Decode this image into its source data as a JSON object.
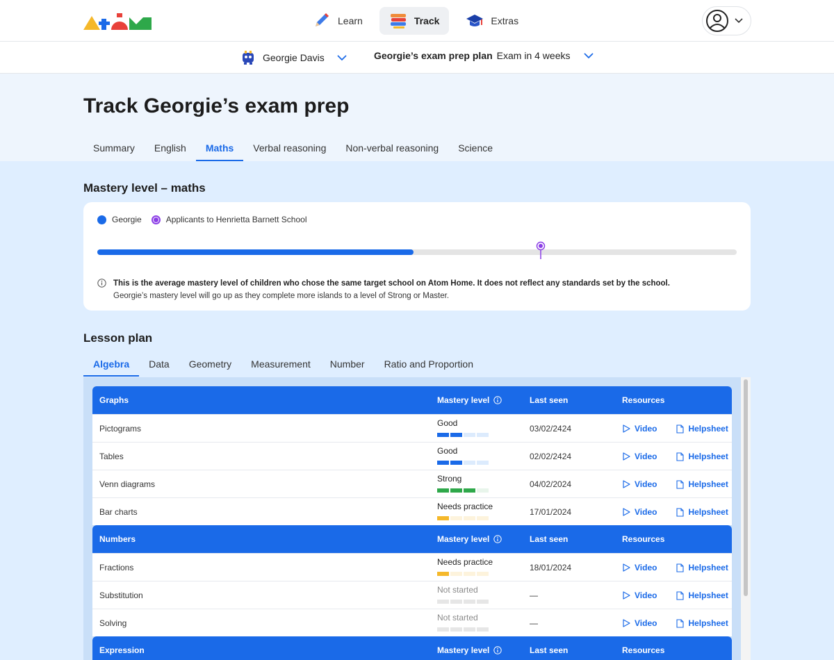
{
  "nav": {
    "items": [
      {
        "label": "Learn",
        "icon": "pencil-icon"
      },
      {
        "label": "Track",
        "icon": "books-icon"
      },
      {
        "label": "Extras",
        "icon": "graduation-cap-icon"
      }
    ]
  },
  "subnav": {
    "child_name": "Georgie Davis",
    "plan_name": "Georgie’s exam prep plan",
    "plan_exam": "Exam in 4 weeks"
  },
  "page": {
    "title": "Track Georgie’s exam prep",
    "tabs": [
      "Summary",
      "English",
      "Maths",
      "Verbal reasoning",
      "Non-verbal reasoning",
      "Science"
    ],
    "active_tab": "Maths"
  },
  "mastery": {
    "heading": "Mastery level – maths",
    "legend_child": "Georgie",
    "legend_applicants": "Applicants to Henrietta Barnett School",
    "child_level": 0.495,
    "applicants_level": 0.693,
    "note_bold": "This is the average mastery level of children who chose the same target school on Atom Home. It does not reflect any standards set by the school.",
    "note_text": "Georgie’s mastery level will go up as they complete more islands to a level of Strong or Master."
  },
  "lesson": {
    "heading": "Lesson plan",
    "tabs": [
      "Algebra",
      "Data",
      "Geometry",
      "Measurement",
      "Number",
      "Ratio and Proportion"
    ],
    "active_tab": "Algebra",
    "col_mastery": "Mastery level",
    "col_last_seen": "Last seen",
    "col_resources": "Resources",
    "video_label": "Video",
    "helpsheet_label": "Helpsheet",
    "groups": [
      {
        "name": "Graphs",
        "rows": [
          {
            "topic": "Pictograms",
            "mastery": "Good",
            "level": 2,
            "last_seen": "03/02/2424"
          },
          {
            "topic": "Tables",
            "mastery": "Good",
            "level": 2,
            "last_seen": "02/02/2424"
          },
          {
            "topic": "Venn diagrams",
            "mastery": "Strong",
            "level": 3,
            "last_seen": "04/02/2024"
          },
          {
            "topic": "Bar charts",
            "mastery": "Needs practice",
            "level": 1,
            "last_seen": "17/01/2024"
          }
        ]
      },
      {
        "name": "Numbers",
        "rows": [
          {
            "topic": "Fractions",
            "mastery": "Needs practice",
            "level": 1,
            "last_seen": "18/01/2024"
          },
          {
            "topic": "Substitution",
            "mastery": "Not started",
            "level": 0,
            "last_seen": "—"
          },
          {
            "topic": "Solving",
            "mastery": "Not started",
            "level": 0,
            "last_seen": "—"
          }
        ]
      },
      {
        "name": "Expression",
        "rows": []
      }
    ]
  },
  "colors": {
    "accent": "#1a6ae8",
    "applicants": "#8b3ee6",
    "good": "#1a6ae8",
    "good_light": "#dcebfd",
    "strong": "#2ea84a",
    "strong_light": "#e8f5eb",
    "needs": "#f5b82a",
    "needs_light": "#fdf3dc",
    "empty": "#e6e6e6"
  }
}
